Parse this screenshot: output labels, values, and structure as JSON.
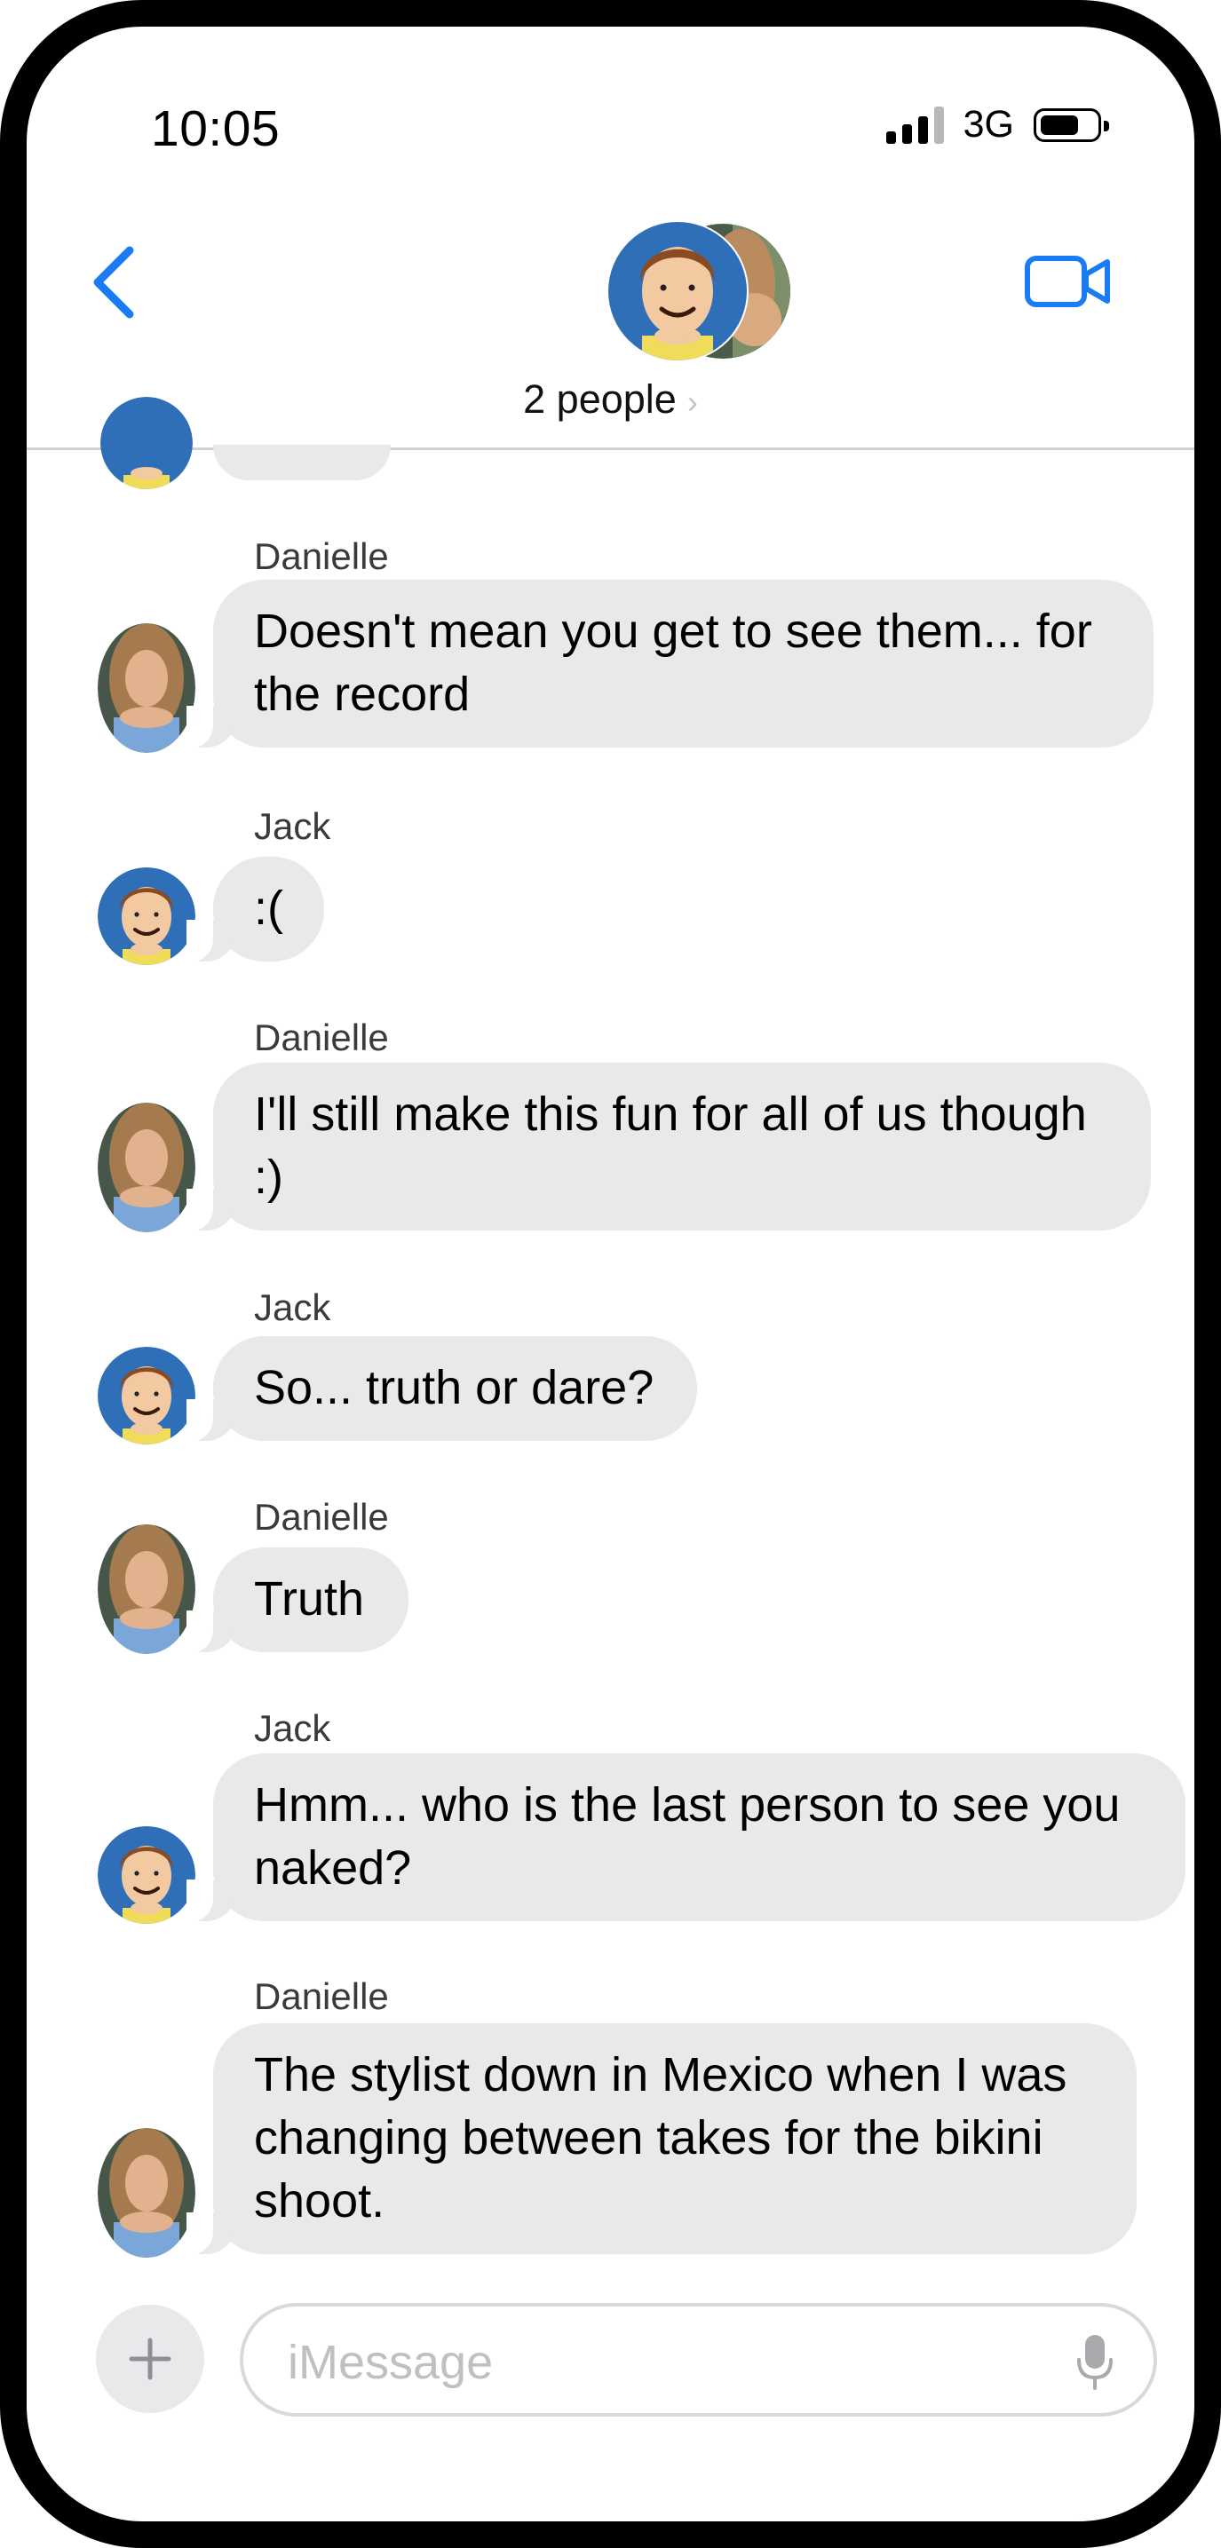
{
  "status_bar": {
    "time": "10:05",
    "network": "3G",
    "signal_bars": 4,
    "battery_level": 0.7
  },
  "header": {
    "back_icon": "chevron-left-icon",
    "video_icon": "video-camera-icon",
    "people_label": "2 people",
    "people_chevron": "›",
    "accent_color": "#007aff"
  },
  "messages": [
    {
      "sender": "Danielle",
      "text": "Doesn't mean you get to see them... for the record"
    },
    {
      "sender": "Jack",
      "text": ":("
    },
    {
      "sender": "Danielle",
      "text": "I'll still make this fun for all of us though :)"
    },
    {
      "sender": "Jack",
      "text": "So... truth or dare?"
    },
    {
      "sender": "Danielle",
      "text": "Truth"
    },
    {
      "sender": "Jack",
      "text": "Hmm... who is the last person to see you naked?"
    },
    {
      "sender": "Danielle",
      "text": "The stylist down in Mexico when I was changing between takes for the bikini shoot."
    }
  ],
  "composer": {
    "placeholder": "iMessage",
    "plus_icon": "plus-icon",
    "mic_icon": "microphone-icon"
  },
  "colors": {
    "bubble_gray": "#e9e9eb",
    "jack_avatar_bg": "#2f6fb8"
  }
}
